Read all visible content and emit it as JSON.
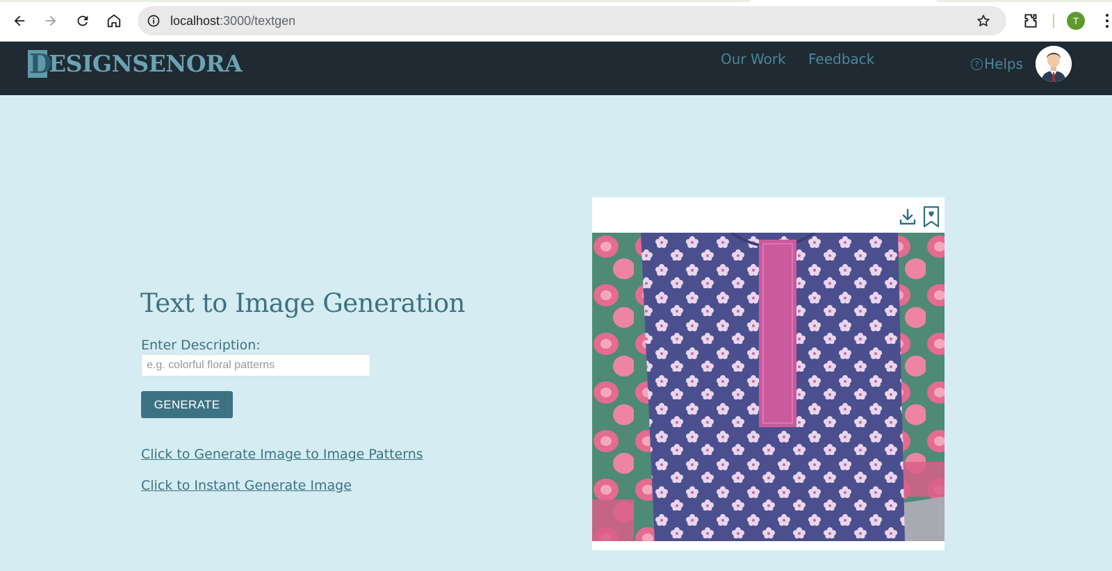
{
  "browser": {
    "url_host": "localhost",
    "url_path": ":3000/textgen",
    "profile_initial": "T"
  },
  "site": {
    "logo_initial": "D",
    "logo_rest": "ESIGNSENORA",
    "nav": [
      {
        "label": "Our Work"
      },
      {
        "label": "Feedback"
      }
    ],
    "helps_label": "Helps",
    "help_icon_glyph": "?"
  },
  "main": {
    "title": "Text to Image Generation",
    "description_label": "Enter Description:",
    "description_placeholder": "e.g. colorful floral patterns",
    "description_value": "",
    "generate_label": "GENERATE",
    "links": [
      {
        "label": "Click to Generate Image to Image Patterns"
      },
      {
        "label": "Click to Instant Generate Image"
      }
    ]
  },
  "image_card": {
    "actions": [
      "download-icon",
      "bookmark-heart-icon"
    ]
  },
  "colors": {
    "page_bg": "#d5ecf2",
    "header_bg": "#1f2a33",
    "accent": "#3d7283",
    "nav_link": "#4d8597"
  }
}
